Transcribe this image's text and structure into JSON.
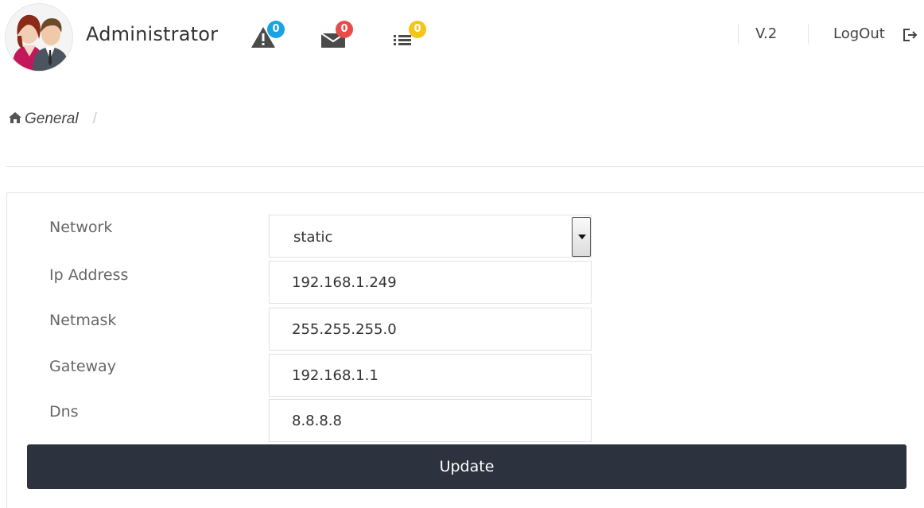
{
  "header": {
    "username": "Administrator",
    "alerts": {
      "icon": "warning-icon",
      "count": "0",
      "color": "#1aa3e0"
    },
    "messages": {
      "icon": "envelope-icon",
      "count": "0",
      "color": "#e94b4b"
    },
    "tasks": {
      "icon": "list-icon",
      "count": "0",
      "color": "#f5c518"
    },
    "version": "V.2",
    "logout_label": "LogOut",
    "logout_icon": "sign-out-icon"
  },
  "breadcrumb": {
    "home_icon": "home-icon",
    "current": "General",
    "separator": "/"
  },
  "form": {
    "network": {
      "label": "Network",
      "value": "static"
    },
    "ip_address": {
      "label": "Ip Address",
      "value": "192.168.1.249"
    },
    "netmask": {
      "label": "Netmask",
      "value": "255.255.255.0"
    },
    "gateway": {
      "label": "Gateway",
      "value": "192.168.1.1"
    },
    "dns": {
      "label": "Dns",
      "value": "8.8.8.8"
    },
    "update_label": "Update",
    "button_color": "#2c323e"
  }
}
